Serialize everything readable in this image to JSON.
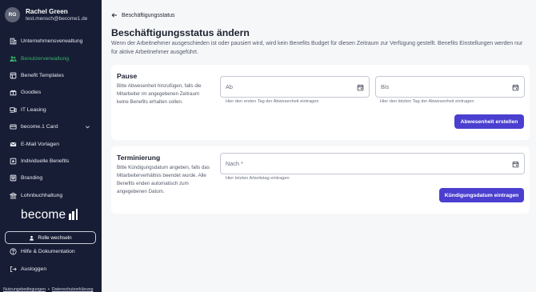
{
  "user": {
    "initials": "RG",
    "name": "Rachel Green",
    "email": "test.mensch@become1.de"
  },
  "sidebar": {
    "items": [
      {
        "label": "Unternehmensverwaltung",
        "icon": "building-icon",
        "active": false
      },
      {
        "label": "Benutzerverwaltung",
        "icon": "users-icon",
        "active": true
      },
      {
        "label": "Benefit Templates",
        "icon": "template-icon",
        "active": false
      },
      {
        "label": "Goodies",
        "icon": "gift-icon",
        "active": false
      },
      {
        "label": "IT Leasing",
        "icon": "laptop-icon",
        "active": false
      },
      {
        "label": "become.1 Card",
        "icon": "card-icon",
        "active": false
      },
      {
        "label": "E-Mail Vorlagen",
        "icon": "mail-icon",
        "active": false
      },
      {
        "label": "Individuelle Benefits",
        "icon": "star-icon",
        "active": false
      },
      {
        "label": "Branding",
        "icon": "palette-icon",
        "active": false
      },
      {
        "label": "Lohnbuchhaltung",
        "icon": "bank-icon",
        "active": false
      }
    ],
    "brand": "become",
    "role_button": "Rolle wechseln",
    "help": "Hilfe & Dokumentation",
    "logout": "Ausloggen",
    "legal": {
      "terms": "Nutzungsbedingungen",
      "separator": "•",
      "privacy": "Datenschutzerklärung"
    }
  },
  "main": {
    "back_label": "Beschäftigungsstatus",
    "title": "Beschäftigungsstatus ändern",
    "description": "Wenn der Arbeitnehmer ausgeschieden ist oder pausiert wird, wird kein Benefits Budget für diesen Zeitraum zur Verfügung gestellt. Benefits Einstellungen werden nur für aktive Arbeitnehmer ausgeführt.",
    "pause": {
      "title": "Pause",
      "description": "Bitte Abwesenheit hinzufügen, falls die Mitarbeiter im angegebenen Zeitraum keine Benefits erhalten sollen.",
      "from_placeholder": "Ab",
      "from_helper": "Hier den ersten Tag der Abwesenheit eintragen",
      "to_placeholder": "Bis",
      "to_helper": "Hier den letzten Tag der Abwesenheit eintragen",
      "button": "Abwesenheit erstellen"
    },
    "termination": {
      "title": "Terminierung",
      "description": "Bitte Kündigungsdatum angeben, falls das Mitarbeiterverhältnis beendet wurde. Alle Benefits enden automatisch zum angegebenen Datum.",
      "after_placeholder": "Nach *",
      "after_helper": "Hier letzten Arbeitstag eintragen",
      "button": "Kündigungsdatum eintragen"
    }
  },
  "colors": {
    "sidebar_bg": "#171d35",
    "active": "#38b36b",
    "primary": "#4b3fd0",
    "background": "#f6f7f9"
  }
}
